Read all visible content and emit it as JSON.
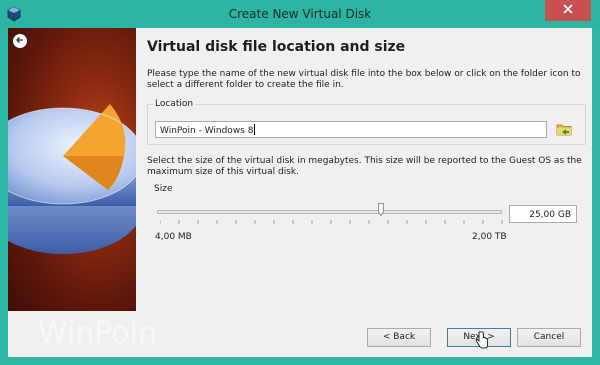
{
  "window": {
    "title": "Create New Virtual Disk"
  },
  "page": {
    "heading": "Virtual disk file location and size",
    "intro": "Please type the name of the new virtual disk file into the box below or click on the folder icon to select a different folder to create the file in."
  },
  "location": {
    "group_label": "Location",
    "value": "WinPoin - Windows 8"
  },
  "size": {
    "description": "Select the size of the virtual disk in megabytes. This size will be reported to the Guest OS as the maximum size of this virtual disk.",
    "group_label": "Size",
    "min_label": "4,00 MB",
    "max_label": "2,00 TB",
    "value": "25,00 GB"
  },
  "buttons": {
    "back": "< Back",
    "next": "Next >",
    "cancel": "Cancel"
  },
  "watermark": "WinPoin",
  "icons": {
    "app": "virtualbox-icon",
    "close": "close-icon",
    "back_arrow": "back-arrow-icon",
    "folder": "folder-icon"
  },
  "colors": {
    "titlebar": "#2cb5a3",
    "close": "#c75050",
    "dialog": "#f0f0f0"
  }
}
